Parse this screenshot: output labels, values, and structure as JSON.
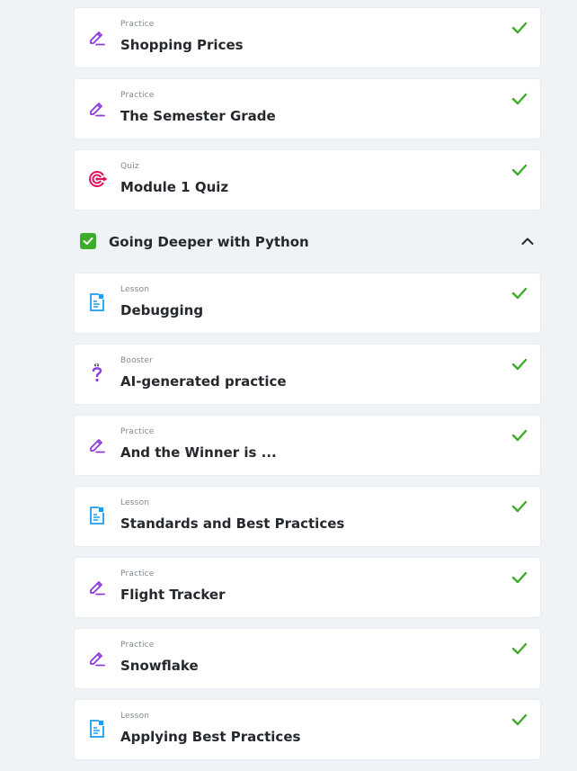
{
  "colors": {
    "practice": "#8c3bdc",
    "quiz": "#e0115f",
    "lesson": "#1c9ff0",
    "booster": "#8c3bdc",
    "check": "#3fab2a",
    "background": "#f0f3f6"
  },
  "items_top": [
    {
      "kind": "Practice",
      "title": "Shopping Prices",
      "icon": "pencil-icon"
    },
    {
      "kind": "Practice",
      "title": "The Semester Grade",
      "icon": "pencil-icon"
    },
    {
      "kind": "Quiz",
      "title": "Module 1 Quiz",
      "icon": "target-icon"
    }
  ],
  "section": {
    "title": "Going Deeper with Python",
    "checkbox_icon": "checkbox-checked-icon",
    "toggle_icon": "chevron-up-icon"
  },
  "items_bottom": [
    {
      "kind": "Lesson",
      "title": "Debugging",
      "icon": "document-icon"
    },
    {
      "kind": "Booster",
      "title": "AI-generated practice",
      "icon": "question-mark-icon"
    },
    {
      "kind": "Practice",
      "title": "And the Winner is ...",
      "icon": "pencil-icon"
    },
    {
      "kind": "Lesson",
      "title": "Standards and Best Practices",
      "icon": "document-icon"
    },
    {
      "kind": "Practice",
      "title": "Flight Tracker",
      "icon": "pencil-icon"
    },
    {
      "kind": "Practice",
      "title": "Snowflake",
      "icon": "pencil-icon"
    },
    {
      "kind": "Lesson",
      "title": "Applying Best Practices",
      "icon": "document-icon"
    }
  ]
}
